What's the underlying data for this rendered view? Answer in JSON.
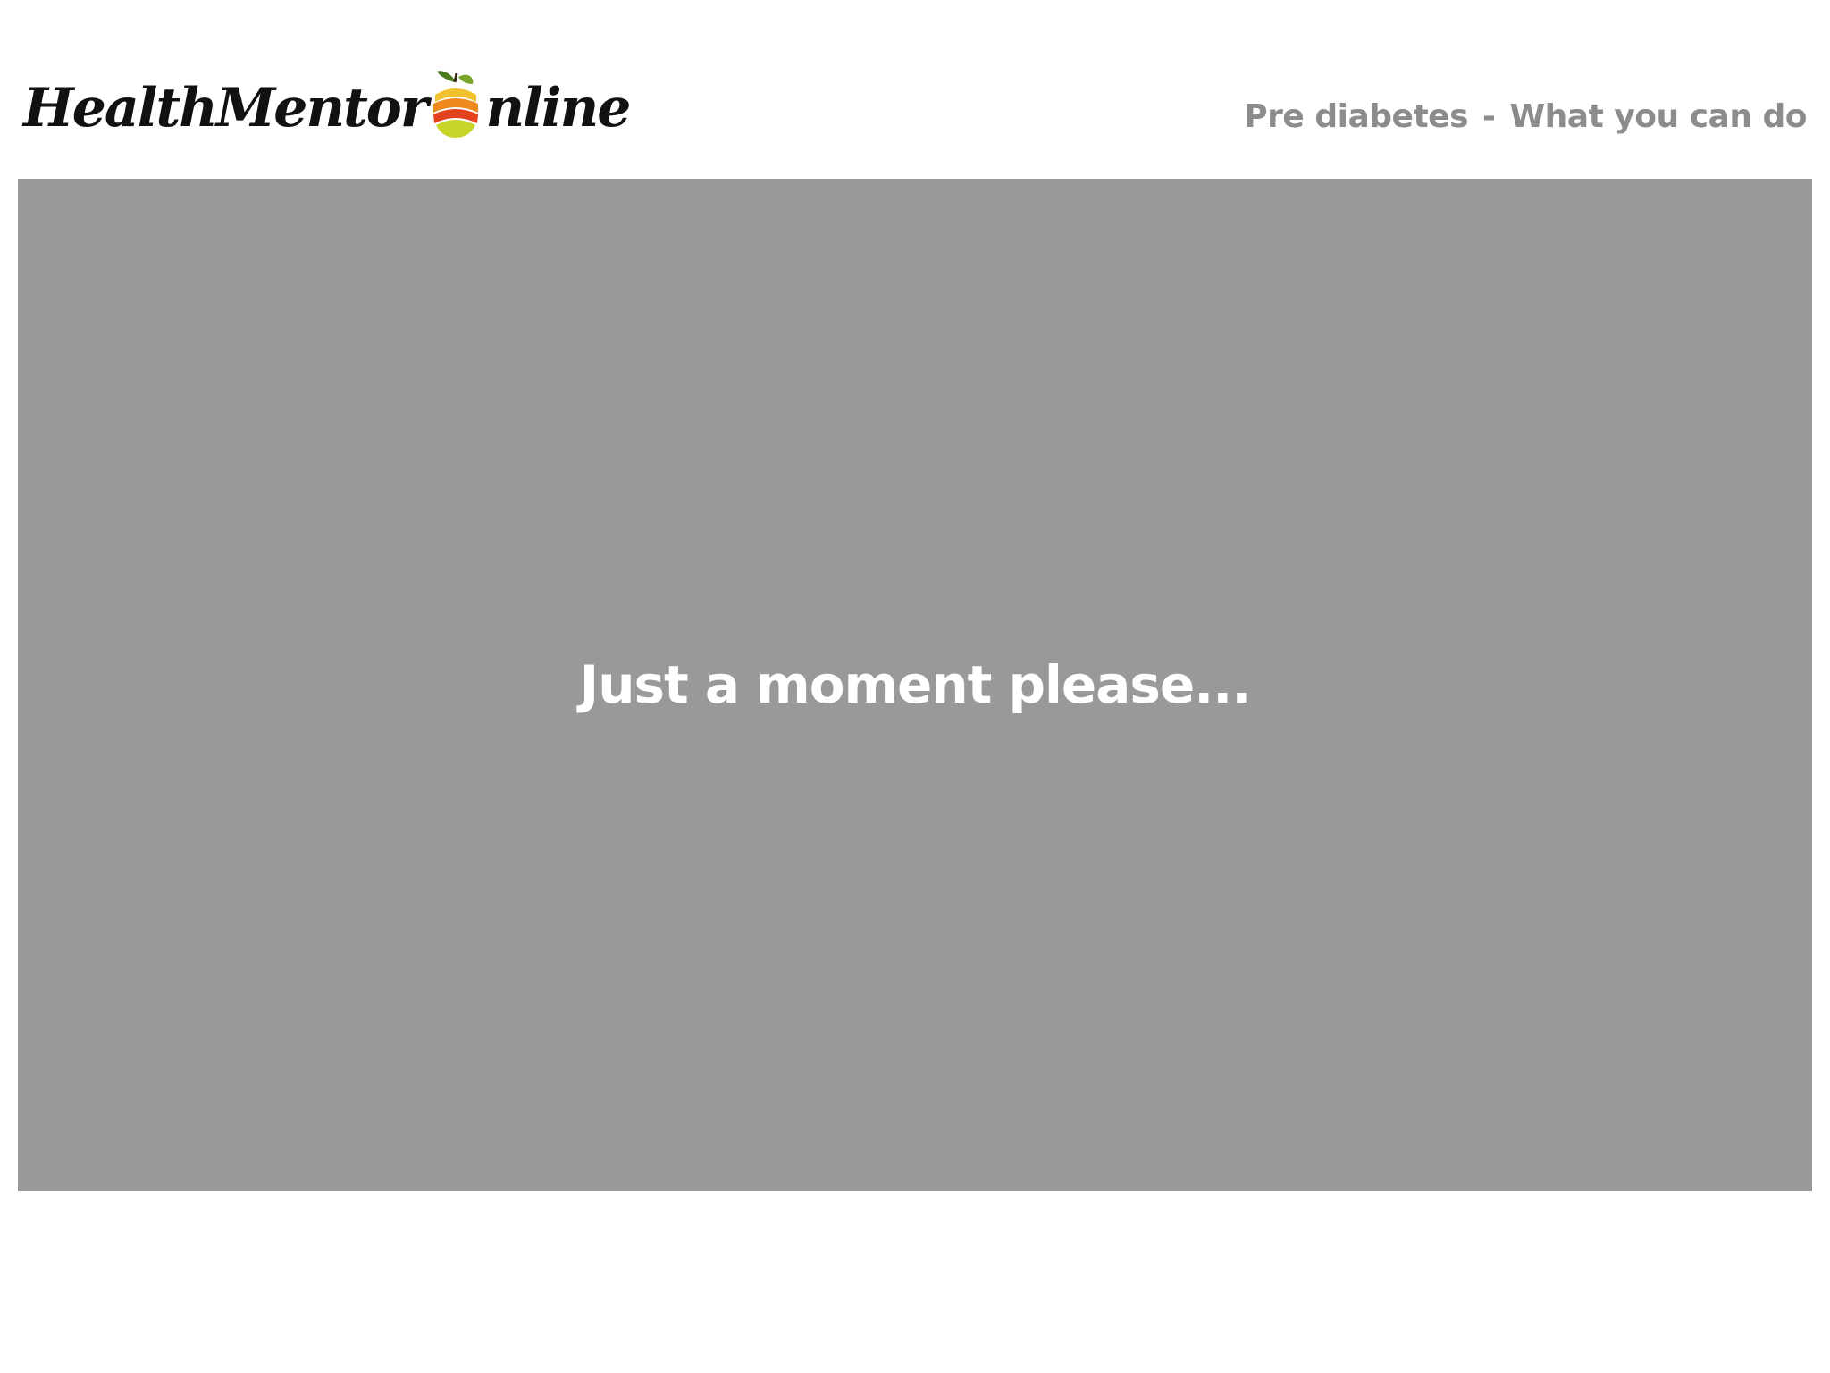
{
  "header": {
    "logo": {
      "part1": "HealthMentor",
      "part2": "nline",
      "icon": "fruit-o-icon"
    },
    "breadcrumb": {
      "item1": "Pre diabetes",
      "separator": "-",
      "item2": "What you can do"
    }
  },
  "main": {
    "loading_message": "Just a moment please..."
  },
  "colors": {
    "stage_background": "#999999",
    "breadcrumb_text": "#8c8c8c",
    "loading_text": "#ffffff"
  }
}
